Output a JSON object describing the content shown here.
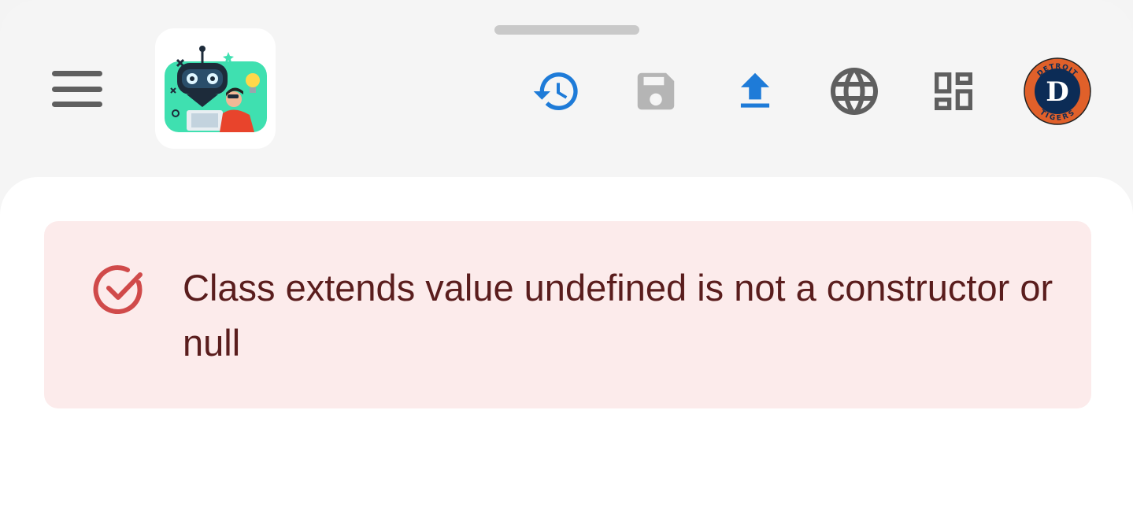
{
  "toolbar": {
    "menu_icon": "hamburger-menu-icon",
    "logo_icon": "robot-developer-logo",
    "actions": [
      {
        "name": "history",
        "icon": "history-icon",
        "color": "#1e7bd8"
      },
      {
        "name": "save",
        "icon": "save-icon",
        "color": "#b5b5b5"
      },
      {
        "name": "upload",
        "icon": "upload-icon",
        "color": "#1e7bd8"
      },
      {
        "name": "language",
        "icon": "globe-icon",
        "color": "#5f5f5f"
      },
      {
        "name": "dashboard",
        "icon": "dashboard-icon",
        "color": "#5f5f5f"
      }
    ],
    "avatar": {
      "icon": "detroit-tigers-avatar",
      "top_text": "DETROIT",
      "bottom_text": "TIGERS",
      "letter": "D",
      "ring_color": "#e0602a",
      "center_color": "#0c2c56"
    }
  },
  "alert": {
    "message": "Class extends value undefined is not a constructor or null",
    "icon": "check-circle-icon",
    "background": "#fcebeb",
    "text_color": "#5a1d1d",
    "icon_color": "#d04a4a"
  }
}
